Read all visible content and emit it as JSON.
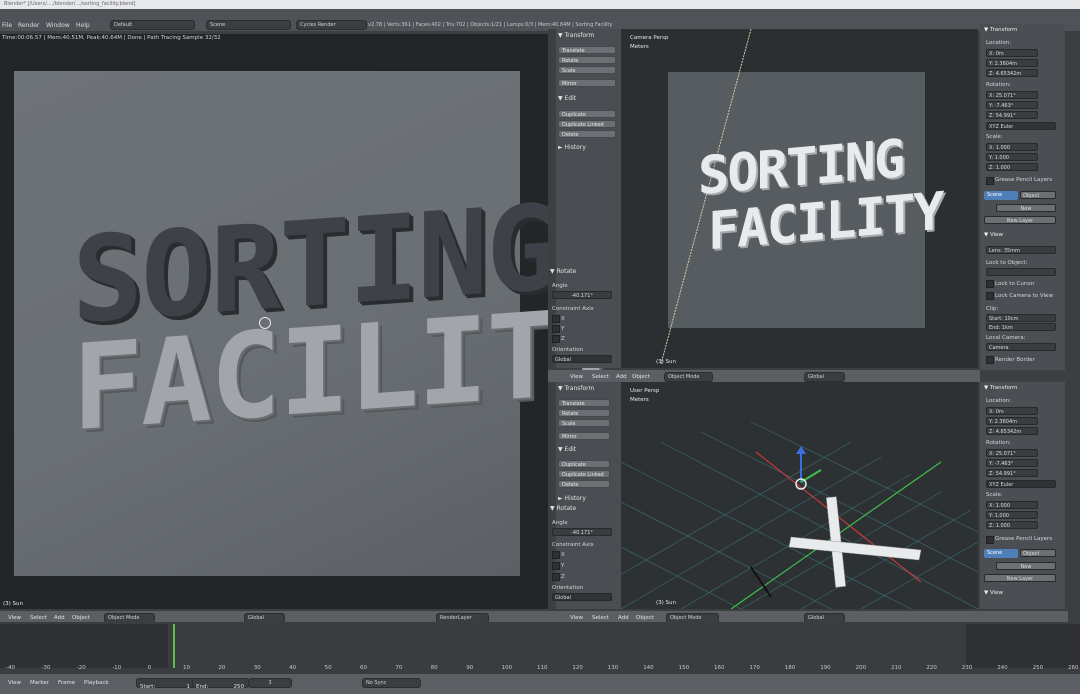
{
  "title_bar": {
    "text": "Blender* [/Users/..../blender/.../sorting_facility.blend]"
  },
  "menu": {
    "items": [
      "File",
      "Render",
      "Window",
      "Help"
    ],
    "layout": "Default",
    "scene": "Scene",
    "engine": "Cycles Render",
    "stats": "v2.78 | Verts:361 | Faces:402 | Tris:702 | Objects:1/21 | Lamps:0/3 | Mem:40.84M | Sorting Facility"
  },
  "render_view": {
    "info": "Time:00:06.57 | Mem:40.51M, Peak:40.64M | Done | Path Tracing Sample 32/32",
    "line1": "SORTING",
    "line2": "FACILITY",
    "bottom_label": "(3) Sun"
  },
  "toolshelf_top": {
    "transform": "▼ Transform",
    "buttons_transform": [
      "Translate",
      "Rotate",
      "Scale",
      "Mirror"
    ],
    "edit": "▼ Edit",
    "buttons_edit": [
      "Duplicate",
      "Duplicate Linked",
      "Delete"
    ],
    "history": "► History",
    "rotate": "▼ Rotate",
    "angle_label": "Angle",
    "angle_value": "-40.171°",
    "constraint_label": "Constraint Axis",
    "axes": [
      "X",
      "Y",
      "Z"
    ],
    "orientation_label": "Orientation",
    "orientation_value": "Global"
  },
  "toolshelf_bottom": {
    "transform": "▼ Transform",
    "buttons_transform": [
      "Translate",
      "Rotate",
      "Scale",
      "Mirror"
    ],
    "edit": "▼ Edit",
    "buttons_edit": [
      "Duplicate",
      "Duplicate Linked",
      "Delete"
    ],
    "history": "► History",
    "rotate": "▼ Rotate",
    "angle_label": "Angle",
    "angle_value": "-40.171°",
    "constraint_label": "Constraint Axis",
    "axes": [
      "X",
      "Y",
      "Z"
    ],
    "orientation_label": "Orientation",
    "orientation_value": "Global"
  },
  "camera_view": {
    "label": "Camera Persp",
    "units": "Meters",
    "line1": "SORTING",
    "line2": "FACILITY",
    "bottom_label": "(3) Sun"
  },
  "user_view": {
    "label": "User Persp",
    "units": "Meters",
    "bottom_label": "(3) Sun"
  },
  "props_top": {
    "transform": "▼ Transform",
    "location": "Location:",
    "loc": [
      "X:        0m",
      "Y:   2.3604m",
      "Z:   4.65342m"
    ],
    "rotation": "Rotation:",
    "rot": [
      "X:   25.071°",
      "Y:   -7.463°",
      "Z:   54.991°"
    ],
    "euler": "XYZ Euler",
    "scale": "Scale:",
    "scl": [
      "X:   1.000",
      "Y:   1.000",
      "Z:   1.000"
    ],
    "grease": "Grease Pencil Layers",
    "scene_tab": "Scene",
    "object_tab": "Object",
    "new_btn": "New",
    "new_layer": "New Layer",
    "view": "▼ View",
    "lens": "Lens:          35mm",
    "lock_object": "Lock to Object:",
    "lock_cursor": "Lock to Cursor",
    "lock_camera": "Lock Camera to View",
    "clip": "Clip:",
    "clip_start": "Start:    10cm",
    "clip_end": "End:       1km",
    "local_camera": "Local Camera:",
    "camera": "Camera",
    "render_border": "Render Border"
  },
  "props_bottom": {
    "transform": "▼ Transform",
    "location": "Location:",
    "loc": [
      "X:        0m",
      "Y:   2.3604m",
      "Z:   4.65342m"
    ],
    "rotation": "Rotation:",
    "rot": [
      "X:   25.071°",
      "Y:   -7.463°",
      "Z:   54.991°"
    ],
    "euler": "XYZ Euler",
    "scale": "Scale:",
    "scl": [
      "X:   1.000",
      "Y:   1.000",
      "Z:   1.000"
    ],
    "grease": "Grease Pencil Layers",
    "scene_tab": "Scene",
    "object_tab": "Object",
    "new_btn": "New",
    "new_layer": "New Layer",
    "view": "▼ View"
  },
  "header_mid": {
    "items": [
      "View",
      "Select",
      "Add",
      "Object"
    ],
    "mode": "Object Mode",
    "orient": "Global"
  },
  "header_bottom_left": {
    "items": [
      "View",
      "Select",
      "Add",
      "Object"
    ],
    "mode": "Object Mode",
    "orient": "Global",
    "renderlayer": "RenderLayer"
  },
  "header_bottom_right": {
    "items": [
      "View",
      "Select",
      "Add",
      "Object"
    ],
    "mode": "Object Mode",
    "orient": "Global"
  },
  "timeline": {
    "ticks": [
      "-40",
      "-30",
      "-20",
      "-10",
      "0",
      "10",
      "20",
      "30",
      "40",
      "50",
      "60",
      "70",
      "80",
      "90",
      "100",
      "110",
      "120",
      "130",
      "140",
      "150",
      "160",
      "170",
      "180",
      "190",
      "200",
      "210",
      "220",
      "230",
      "240",
      "250",
      "260"
    ],
    "menu": [
      "View",
      "Marker",
      "Frame",
      "Playback"
    ],
    "start": "Start:",
    "start_val": "1",
    "end": "End:",
    "end_val": "250",
    "current": "3",
    "sync": "No Sync"
  },
  "colors": {
    "accent": "#4f7fb8",
    "grid_red": "#c23b3b",
    "grid_green": "#3fbf4a",
    "background": "#3c3f42"
  }
}
